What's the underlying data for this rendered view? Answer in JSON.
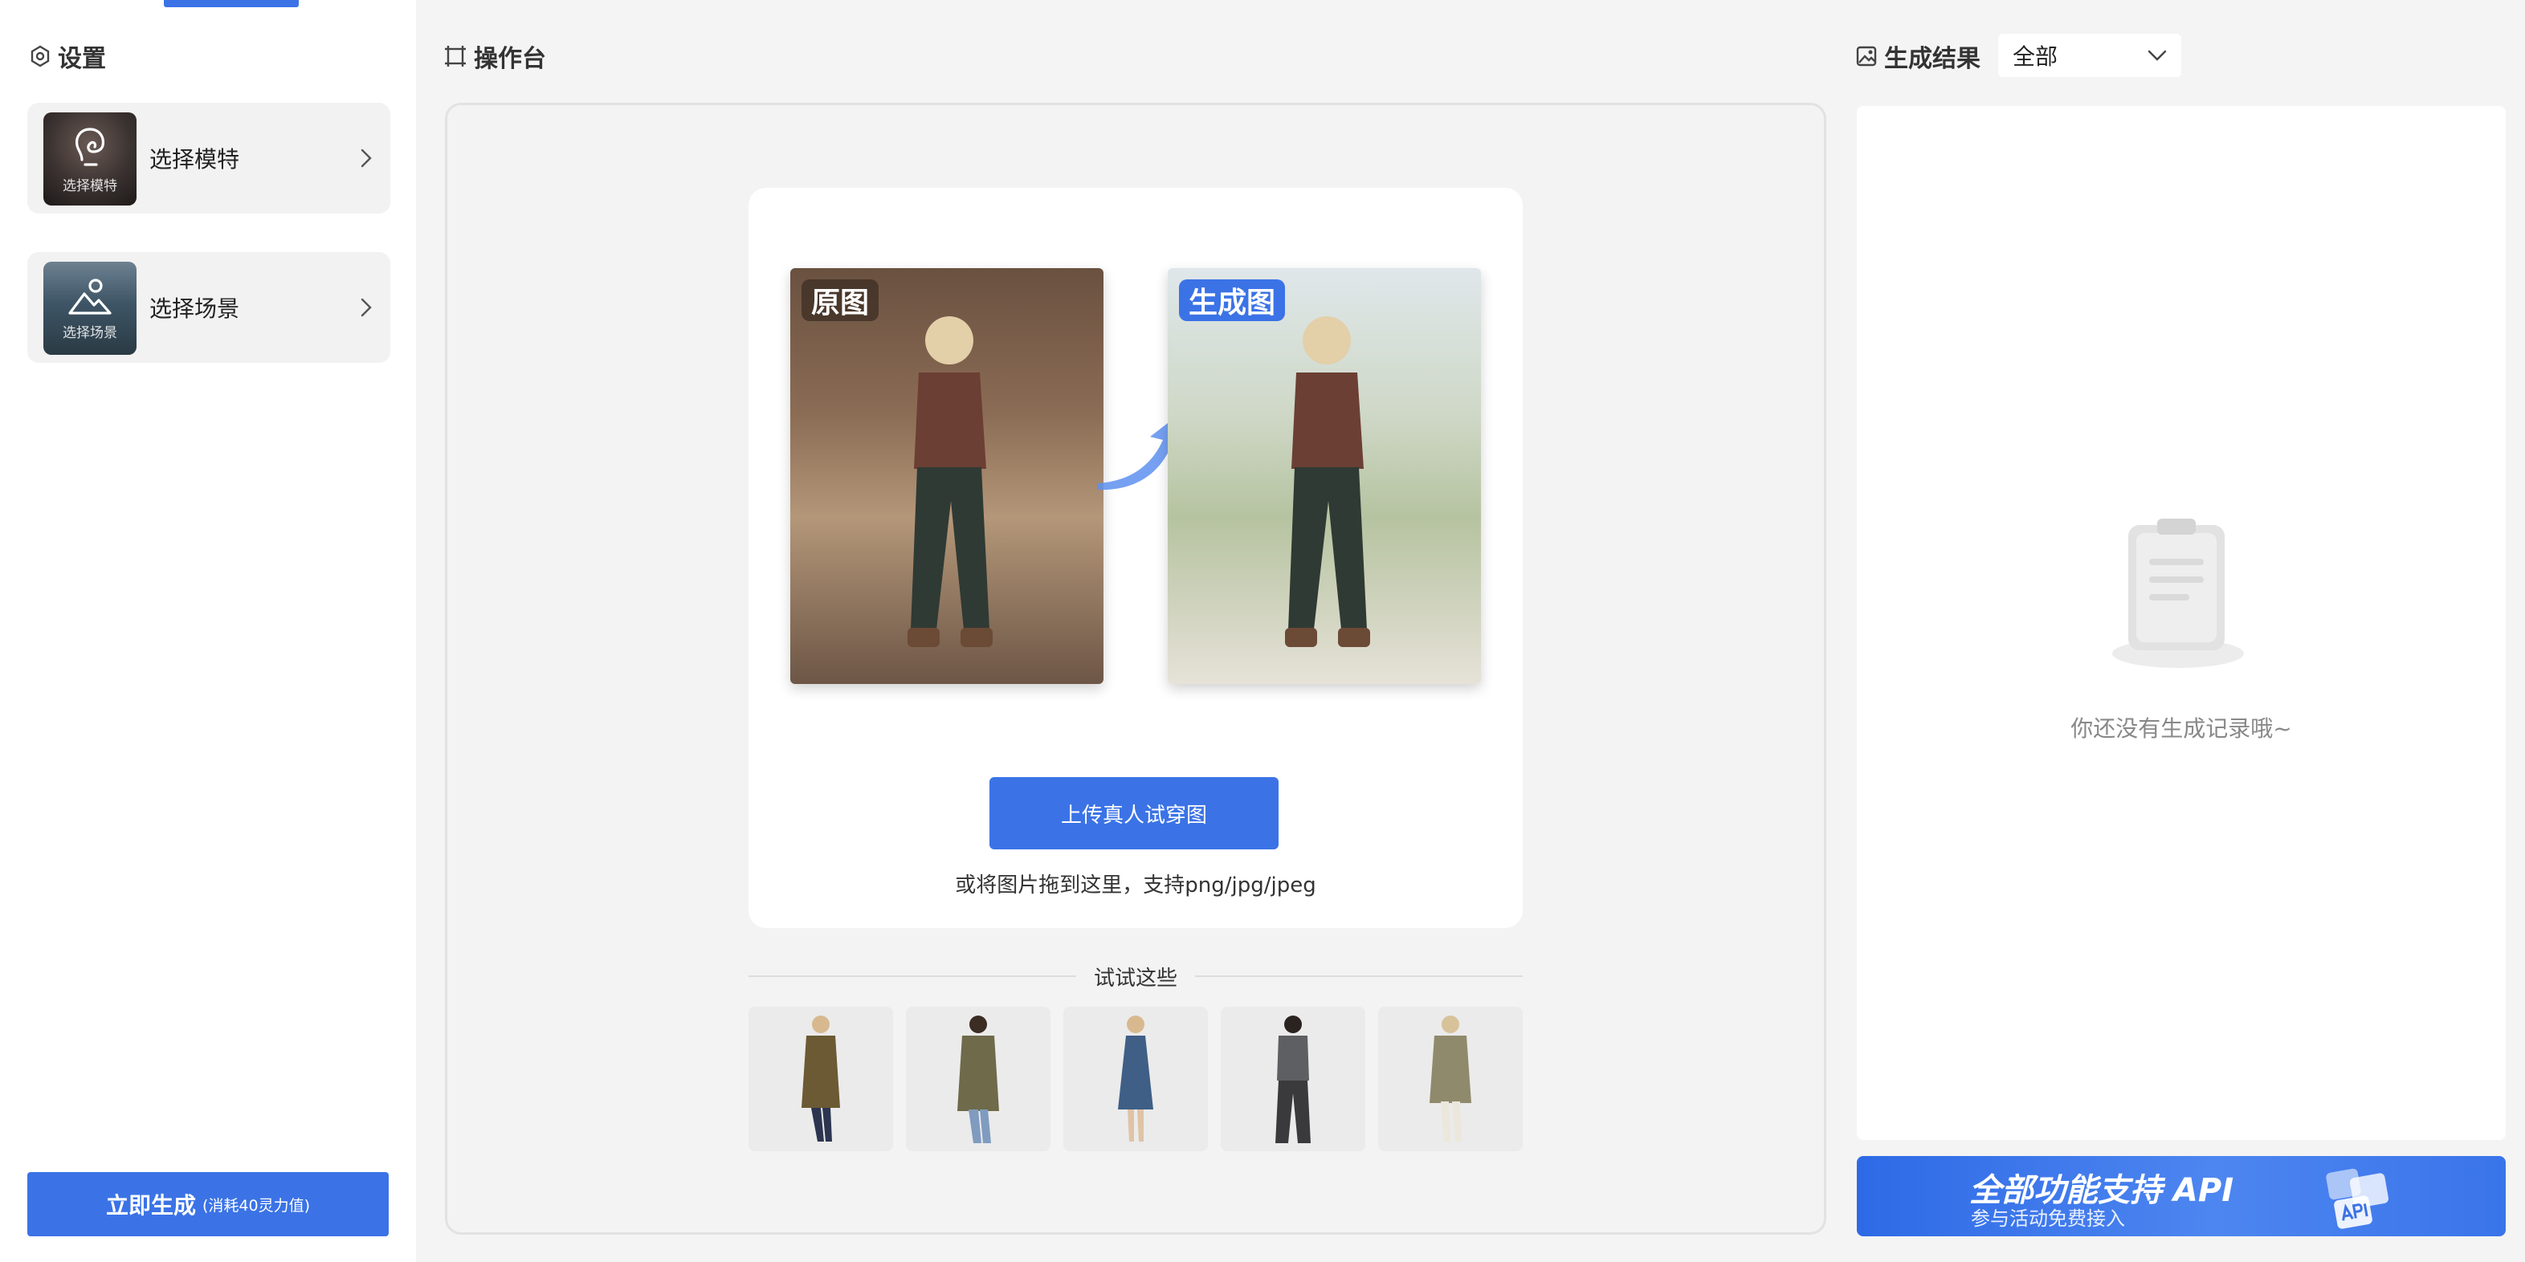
{
  "settings": {
    "title": "设置",
    "options": [
      {
        "label": "选择模特",
        "thumb_caption": "选择模特",
        "icon": "face-sketch-icon"
      },
      {
        "label": "选择场景",
        "thumb_caption": "选择场景",
        "icon": "mountain-scene-icon"
      }
    ],
    "generate_button": {
      "label": "立即生成",
      "cost_note": "(消耗40灵力值)"
    }
  },
  "workspace": {
    "title": "操作台",
    "example": {
      "original_tag": "原图",
      "generated_tag": "生成图"
    },
    "upload_button": "上传真人试穿图",
    "upload_hint": "或将图片拖到这里，支持png/jpg/jpeg",
    "try_label": "试试这些",
    "samples": [
      {
        "name": "brown-coat",
        "color": "#6b5a33"
      },
      {
        "name": "trench-coat",
        "color": "#6e6a4a"
      },
      {
        "name": "floral-dress",
        "color": "#3f5f86"
      },
      {
        "name": "grey-blazer",
        "color": "#5e5f63"
      },
      {
        "name": "khaki-coat",
        "color": "#8f8a6c"
      }
    ]
  },
  "results": {
    "title": "生成结果",
    "filter_value": "全部",
    "empty_text": "你还没有生成记录哦~",
    "api_banner": {
      "title": "全部功能支持 API",
      "subtitle": "参与活动免费接入"
    }
  },
  "colors": {
    "accent": "#3b73e6",
    "background": "#f4f4f4",
    "card": "#ffffff"
  }
}
